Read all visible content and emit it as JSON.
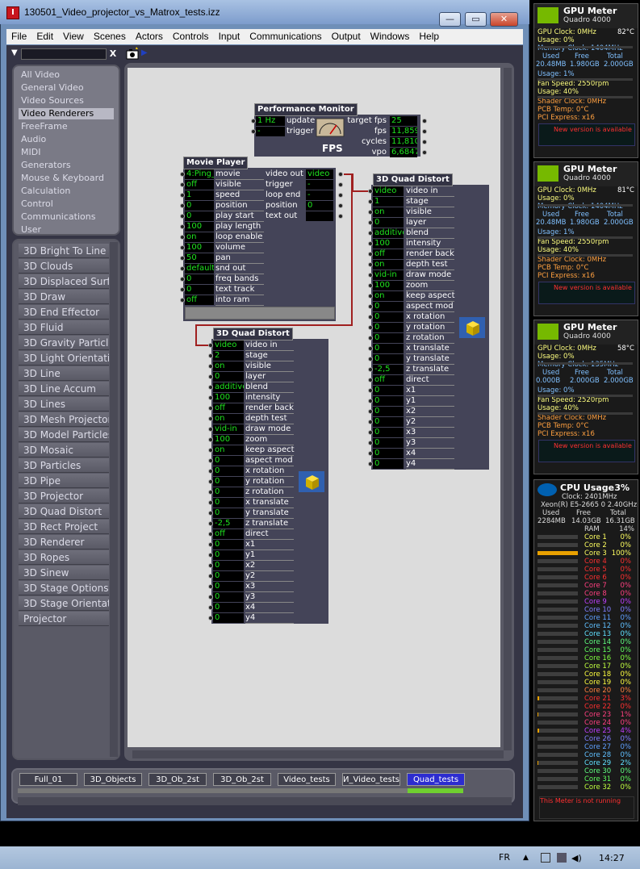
{
  "window": {
    "title": "130501_Video_projector_vs_Matrox_tests.izz",
    "app_icon_label": "I",
    "controls": {
      "minimize": "—",
      "maximize": "▭",
      "close": "✕"
    }
  },
  "menu": [
    "File",
    "Edit",
    "View",
    "Scenes",
    "Actors",
    "Controls",
    "Input",
    "Communications",
    "Output",
    "Windows",
    "Help"
  ],
  "filter": {
    "value": "",
    "clear_label": "X"
  },
  "categories": [
    {
      "label": "All Video"
    },
    {
      "label": "General Video"
    },
    {
      "label": "Video Sources"
    },
    {
      "label": "Video Renderers",
      "selected": true
    },
    {
      "label": "FreeFrame"
    },
    {
      "label": "Audio"
    },
    {
      "label": "MIDI"
    },
    {
      "label": "Generators"
    },
    {
      "label": "Mouse & Keyboard"
    },
    {
      "label": "Calculation"
    },
    {
      "label": "Control"
    },
    {
      "label": "Communications"
    },
    {
      "label": "User"
    }
  ],
  "actors_list": [
    "3D Bright To Line",
    "3D Clouds",
    "3D Displaced Surf",
    "3D Draw",
    "3D End Effector",
    "3D Fluid",
    "3D Gravity Particl",
    "3D Light Orientatio",
    "3D Line",
    "3D Line Accum",
    "3D Lines",
    "3D Mesh Projector",
    "3D Model Particles",
    "3D Mosaic",
    "3D Particles",
    "3D Pipe",
    "3D Projector",
    "3D Quad Distort",
    "3D Rect Project",
    "3D Renderer",
    "3D Ropes",
    "3D Sinew",
    "3D Stage Options",
    "3D Stage Orientat",
    "Projector"
  ],
  "perf_monitor": {
    "title": "Performance Monitor",
    "inputs": [
      {
        "value": "1 Hz",
        "label": "update"
      },
      {
        "value": "-",
        "label": "trigger"
      }
    ],
    "outputs": [
      {
        "label": "target fps",
        "value": "25"
      },
      {
        "label": "fps",
        "value": "11,859"
      },
      {
        "label": "cycles",
        "value": "11,810"
      },
      {
        "label": "vpo",
        "value": "6,6847"
      }
    ],
    "fps_label": "FPS"
  },
  "movie_player": {
    "title": "Movie Player",
    "inputs": [
      {
        "value": "4:Ping_",
        "label": "movie"
      },
      {
        "value": "off",
        "label": "visible"
      },
      {
        "value": "1",
        "label": "speed"
      },
      {
        "value": "0",
        "label": "position"
      },
      {
        "value": "0",
        "label": "play start"
      },
      {
        "value": "100",
        "label": "play length"
      },
      {
        "value": "on",
        "label": "loop enable"
      },
      {
        "value": "100",
        "label": "volume"
      },
      {
        "value": "50",
        "label": "pan"
      },
      {
        "value": "default",
        "label": "snd out"
      },
      {
        "value": "0",
        "label": "freq bands"
      },
      {
        "value": "0",
        "label": "text track"
      },
      {
        "value": "off",
        "label": "into ram"
      }
    ],
    "outputs": [
      {
        "label": "video out",
        "value": "video"
      },
      {
        "label": "trigger",
        "value": "-"
      },
      {
        "label": "loop end",
        "value": "-"
      },
      {
        "label": "position",
        "value": "0"
      },
      {
        "label": "text out",
        "value": ""
      }
    ]
  },
  "quad_distort_a": {
    "title": "3D Quad Distort",
    "inputs": [
      {
        "value": "video",
        "label": "video in"
      },
      {
        "value": "1",
        "label": "stage"
      },
      {
        "value": "on",
        "label": "visible"
      },
      {
        "value": "0",
        "label": "layer"
      },
      {
        "value": "additive",
        "label": "blend"
      },
      {
        "value": "100",
        "label": "intensity"
      },
      {
        "value": "off",
        "label": "render back"
      },
      {
        "value": "on",
        "label": "depth test"
      },
      {
        "value": "vid-in",
        "label": "draw mode"
      },
      {
        "value": "100",
        "label": "zoom"
      },
      {
        "value": "on",
        "label": "keep aspect"
      },
      {
        "value": "0",
        "label": "aspect mod"
      },
      {
        "value": "0",
        "label": "x rotation"
      },
      {
        "value": "0",
        "label": "y rotation"
      },
      {
        "value": "0",
        "label": "z rotation"
      },
      {
        "value": "0",
        "label": "x translate"
      },
      {
        "value": "0",
        "label": "y translate"
      },
      {
        "value": "-2,5",
        "label": "z translate"
      },
      {
        "value": "off",
        "label": "direct"
      },
      {
        "value": "0",
        "label": "x1"
      },
      {
        "value": "0",
        "label": "y1"
      },
      {
        "value": "0",
        "label": "x2"
      },
      {
        "value": "0",
        "label": "y2"
      },
      {
        "value": "0",
        "label": "x3"
      },
      {
        "value": "0",
        "label": "y3"
      },
      {
        "value": "0",
        "label": "x4"
      },
      {
        "value": "0",
        "label": "y4"
      }
    ]
  },
  "quad_distort_b": {
    "title": "3D Quad Distort",
    "inputs": [
      {
        "value": "video",
        "label": "video in"
      },
      {
        "value": "2",
        "label": "stage"
      },
      {
        "value": "on",
        "label": "visible"
      },
      {
        "value": "0",
        "label": "layer"
      },
      {
        "value": "additive",
        "label": "blend"
      },
      {
        "value": "100",
        "label": "intensity"
      },
      {
        "value": "off",
        "label": "render back"
      },
      {
        "value": "on",
        "label": "depth test"
      },
      {
        "value": "vid-in",
        "label": "draw mode"
      },
      {
        "value": "100",
        "label": "zoom"
      },
      {
        "value": "on",
        "label": "keep aspect"
      },
      {
        "value": "0",
        "label": "aspect mod"
      },
      {
        "value": "0",
        "label": "x rotation"
      },
      {
        "value": "0",
        "label": "y rotation"
      },
      {
        "value": "0",
        "label": "z rotation"
      },
      {
        "value": "0",
        "label": "x translate"
      },
      {
        "value": "0",
        "label": "y translate"
      },
      {
        "value": "-2,5",
        "label": "z translate"
      },
      {
        "value": "off",
        "label": "direct"
      },
      {
        "value": "0",
        "label": "x1"
      },
      {
        "value": "0",
        "label": "y1"
      },
      {
        "value": "0",
        "label": "x2"
      },
      {
        "value": "0",
        "label": "y2"
      },
      {
        "value": "0",
        "label": "x3"
      },
      {
        "value": "0",
        "label": "y3"
      },
      {
        "value": "0",
        "label": "x4"
      },
      {
        "value": "0",
        "label": "y4"
      }
    ]
  },
  "scenes": [
    {
      "label": "Full_01"
    },
    {
      "label": "3D_Objects"
    },
    {
      "label": "3D_Ob_2st"
    },
    {
      "label": "3D_Ob_2st"
    },
    {
      "label": "Video_tests"
    },
    {
      "label": "И_Video_tests"
    },
    {
      "label": "Quad_tests",
      "selected": true
    }
  ],
  "gpu_meters": [
    {
      "title": "GPU Meter",
      "model": "Quadro 4000",
      "gpu_clock": "GPU Clock: 0MHz",
      "temp": "82°C",
      "usage": "Usage: 0%",
      "mem_clock": "Memory Clock: 1404MHz",
      "mem_head": [
        "Used",
        "Free",
        "Total"
      ],
      "mem_vals": [
        "20.48MB",
        "1.980GB",
        "2.000GB"
      ],
      "mem_usage": "Usage: 1%",
      "fan": "Fan Speed: 2550rpm",
      "fan_usage": "Usage: 40%",
      "shader": "Shader Clock: 0MHz",
      "pcb": "PCB Temp: 0°C",
      "pci": "PCI Express: x16",
      "notice": "New version is available"
    },
    {
      "title": "GPU Meter",
      "model": "Quadro 4000",
      "gpu_clock": "GPU Clock: 0MHz",
      "temp": "81°C",
      "usage": "Usage: 0%",
      "mem_clock": "Memory Clock: 1404MHz",
      "mem_head": [
        "Used",
        "Free",
        "Total"
      ],
      "mem_vals": [
        "20.48MB",
        "1.980GB",
        "2.000GB"
      ],
      "mem_usage": "Usage: 1%",
      "fan": "Fan Speed: 2550rpm",
      "fan_usage": "Usage: 40%",
      "shader": "Shader Clock: 0MHz",
      "pcb": "PCB Temp: 0°C",
      "pci": "PCI Express: x16",
      "notice": "New version is available"
    },
    {
      "title": "GPU Meter",
      "model": "Quadro 4000",
      "gpu_clock": "GPU Clock: 0MHz",
      "temp": "58°C",
      "usage": "Usage: 0%",
      "mem_clock": "Memory Clock: 135MHz",
      "mem_head": [
        "Used",
        "Free",
        "Total"
      ],
      "mem_vals": [
        "0.000B",
        "2.000GB",
        "2.000GB"
      ],
      "mem_usage": "Usage: 0%",
      "fan": "Fan Speed: 2520rpm",
      "fan_usage": "Usage: 40%",
      "shader": "Shader Clock: 0MHz",
      "pcb": "PCB Temp: 0°C",
      "pci": "PCI Express: x16",
      "notice": "New version is available"
    }
  ],
  "cpu": {
    "title": "CPU Usage",
    "total": "3%",
    "clock": "Clock: 2401MHz",
    "model": "Xeon(R) E5-2665 0 2.40GHz",
    "mem_head": [
      "Used",
      "Free",
      "Total"
    ],
    "mem_vals": [
      "2284MB",
      "14.03GB",
      "16.31GB"
    ],
    "ram_label": "RAM",
    "ram_pct": "14%",
    "cores": [
      {
        "name": "Core 1",
        "pct": "0%",
        "level": 0,
        "color": "#ffff60"
      },
      {
        "name": "Core 2",
        "pct": "0%",
        "level": 0,
        "color": "#ffff60"
      },
      {
        "name": "Core 3",
        "pct": "100%",
        "level": 1,
        "color": "#ffff60"
      },
      {
        "name": "Core 4",
        "pct": "0%",
        "level": 0,
        "color": "#ff3030"
      },
      {
        "name": "Core 5",
        "pct": "0%",
        "level": 0,
        "color": "#ff3030"
      },
      {
        "name": "Core 6",
        "pct": "0%",
        "level": 0,
        "color": "#ff3030"
      },
      {
        "name": "Core 7",
        "pct": "0%",
        "level": 0,
        "color": "#ff4080"
      },
      {
        "name": "Core 8",
        "pct": "0%",
        "level": 0,
        "color": "#ff4080"
      },
      {
        "name": "Core 9",
        "pct": "0%",
        "level": 0,
        "color": "#c040ff"
      },
      {
        "name": "Core 10",
        "pct": "0%",
        "level": 0,
        "color": "#8080ff"
      },
      {
        "name": "Core 11",
        "pct": "0%",
        "level": 0,
        "color": "#60a0ff"
      },
      {
        "name": "Core 12",
        "pct": "0%",
        "level": 0,
        "color": "#60c0ff"
      },
      {
        "name": "Core 13",
        "pct": "0%",
        "level": 0,
        "color": "#60e0ff"
      },
      {
        "name": "Core 14",
        "pct": "0%",
        "level": 0,
        "color": "#60ff80"
      },
      {
        "name": "Core 15",
        "pct": "0%",
        "level": 0,
        "color": "#60ff60"
      },
      {
        "name": "Core 16",
        "pct": "0%",
        "level": 0,
        "color": "#80ff40"
      },
      {
        "name": "Core 17",
        "pct": "0%",
        "level": 0,
        "color": "#c0ff40"
      },
      {
        "name": "Core 18",
        "pct": "0%",
        "level": 0,
        "color": "#ffff40"
      },
      {
        "name": "Core 19",
        "pct": "0%",
        "level": 0,
        "color": "#ffff40"
      },
      {
        "name": "Core 20",
        "pct": "0%",
        "level": 0,
        "color": "#ff8040"
      },
      {
        "name": "Core 21",
        "pct": "3%",
        "level": 0.03,
        "color": "#ff3030"
      },
      {
        "name": "Core 22",
        "pct": "0%",
        "level": 0,
        "color": "#ff3030"
      },
      {
        "name": "Core 23",
        "pct": "1%",
        "level": 0.01,
        "color": "#ff4080"
      },
      {
        "name": "Core 24",
        "pct": "0%",
        "level": 0,
        "color": "#ff4080"
      },
      {
        "name": "Core 25",
        "pct": "4%",
        "level": 0.04,
        "color": "#c040ff"
      },
      {
        "name": "Core 26",
        "pct": "0%",
        "level": 0,
        "color": "#8080ff"
      },
      {
        "name": "Core 27",
        "pct": "0%",
        "level": 0,
        "color": "#60a0ff"
      },
      {
        "name": "Core 28",
        "pct": "0%",
        "level": 0,
        "color": "#60c0ff"
      },
      {
        "name": "Core 29",
        "pct": "2%",
        "level": 0.02,
        "color": "#60e0ff"
      },
      {
        "name": "Core 30",
        "pct": "0%",
        "level": 0,
        "color": "#60ff80"
      },
      {
        "name": "Core 31",
        "pct": "0%",
        "level": 0,
        "color": "#60ff60"
      },
      {
        "name": "Core 32",
        "pct": "0%",
        "level": 0,
        "color": "#c0ff40"
      }
    ],
    "notice": "This Meter is not running"
  },
  "taskbar": {
    "lang": "FR",
    "clock": "14:27"
  },
  "colors": {
    "value_text": "#1fe41f",
    "wire": "#a02020",
    "selected_scene": "#2c2cd0",
    "gpu_logo": "#76b900"
  }
}
